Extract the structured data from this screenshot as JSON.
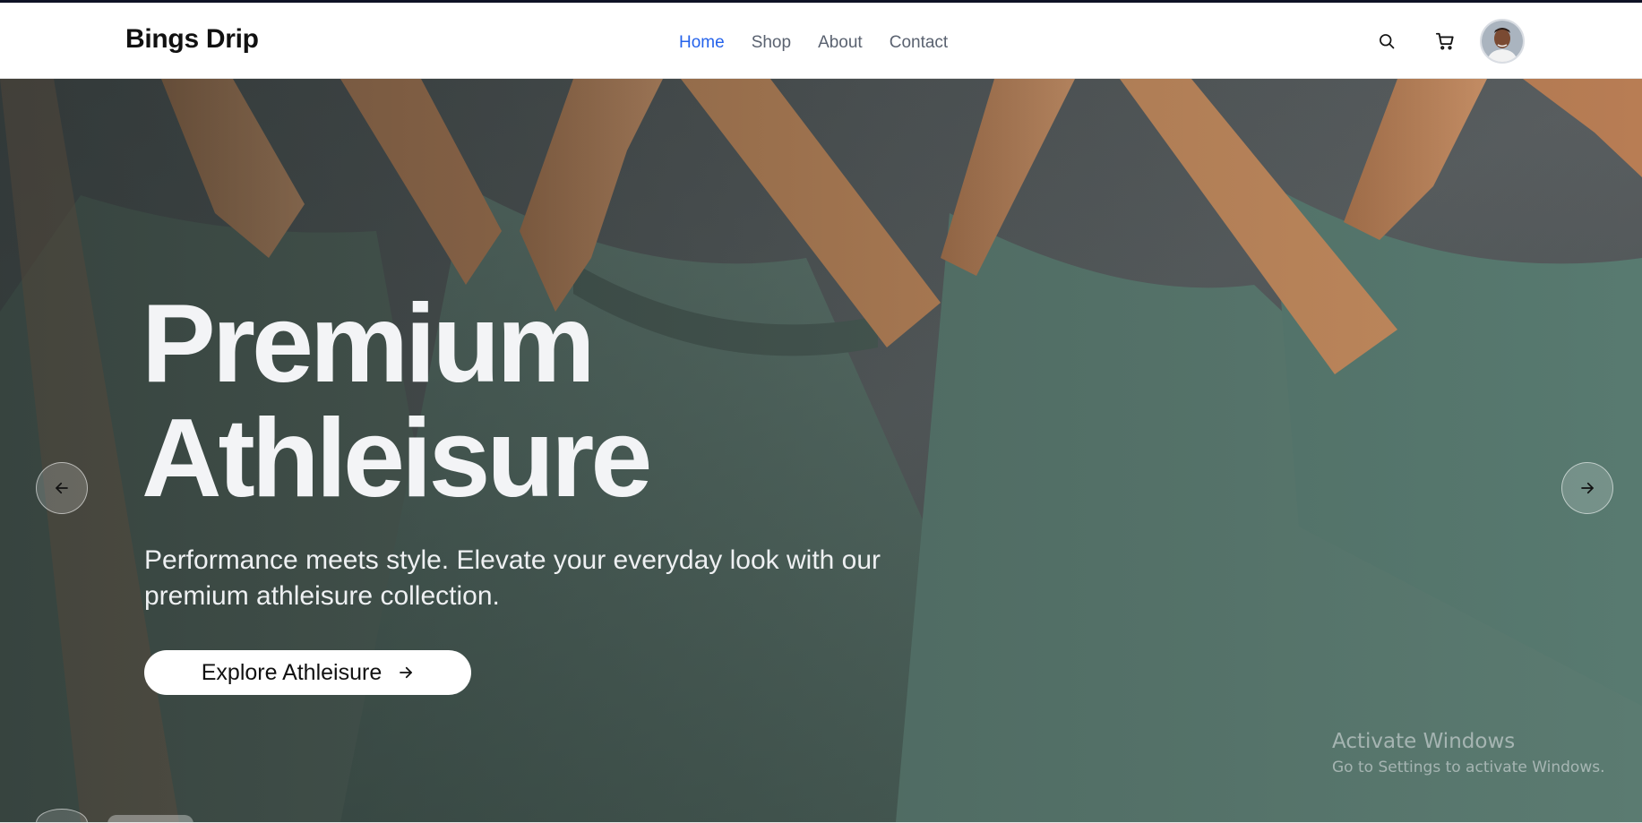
{
  "brand": {
    "name": "Bings Drip"
  },
  "nav": {
    "links": [
      {
        "label": "Home",
        "active": true
      },
      {
        "label": "Shop",
        "active": false
      },
      {
        "label": "About",
        "active": false
      },
      {
        "label": "Contact",
        "active": false
      }
    ],
    "active_color": "#2563eb"
  },
  "header_actions": {
    "search_icon": "search-icon",
    "cart_icon": "cart-icon",
    "avatar": "user-avatar"
  },
  "hero": {
    "title_line1": "Premium",
    "title_line2": "Athleisure",
    "subtitle": "Performance meets style. Elevate your everyday look with our premium athleisure collection.",
    "cta_label": "Explore Athleisure",
    "cta_icon": "arrow-right-icon",
    "prev_icon": "arrow-left-icon",
    "next_icon": "arrow-right-icon"
  },
  "watermark": {
    "title": "Activate Windows",
    "subtitle": "Go to Settings to activate Windows."
  }
}
